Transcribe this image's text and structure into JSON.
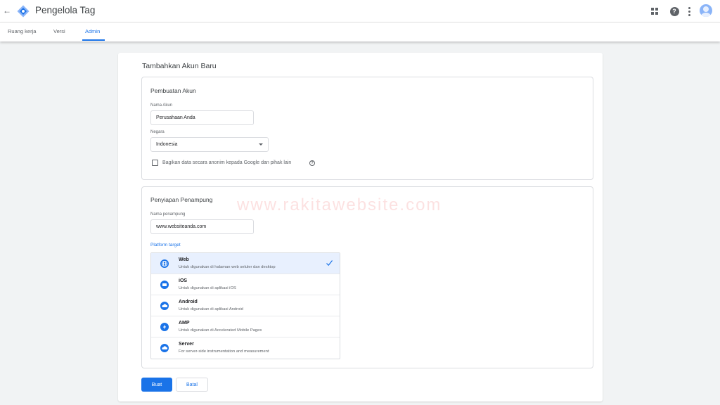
{
  "app": {
    "title": "Pengelola Tag"
  },
  "tabs": [
    {
      "label": "Ruang kerja"
    },
    {
      "label": "Versi"
    },
    {
      "label": "Admin"
    }
  ],
  "page": {
    "title": "Tambahkan Akun Baru"
  },
  "account_setup": {
    "title": "Pembuatan Akun",
    "account_name_label": "Nama Akun",
    "account_name_value": "Perusahaan Anda",
    "country_label": "Negara",
    "country_value": "Indonesia",
    "share_checkbox_label": "Bagikan data secara anonim kepada Google dan pihak lain",
    "share_checked": false
  },
  "container_setup": {
    "title": "Penyiapan Penampung",
    "container_name_label": "Nama penampung",
    "container_name_value": "www.websiteanda.com",
    "platform_label": "Platform target",
    "platforms": [
      {
        "name": "Web",
        "desc": "Untuk digunakan di halaman web seluler dan desktop",
        "icon": "globe-icon",
        "selected": true
      },
      {
        "name": "iOS",
        "desc": "Untuk digunakan di aplikasi iOS",
        "icon": "ios-device-icon",
        "selected": false
      },
      {
        "name": "Android",
        "desc": "Untuk digunakan di aplikasi Android",
        "icon": "android-cloud-icon",
        "selected": false
      },
      {
        "name": "AMP",
        "desc": "Untuk digunakan di Accelerated Mobile Pages",
        "icon": "amp-bolt-icon",
        "selected": false
      },
      {
        "name": "Server",
        "desc": "For server-side instrumentation and measurement",
        "icon": "cloud-icon",
        "selected": false
      }
    ]
  },
  "actions": {
    "create_label": "Buat",
    "cancel_label": "Batal"
  },
  "watermark": "www.rakitawebsite.com",
  "colors": {
    "accent": "#1a73e8",
    "selected_bg": "#e8f0fe",
    "background": "#f1f3f4"
  }
}
